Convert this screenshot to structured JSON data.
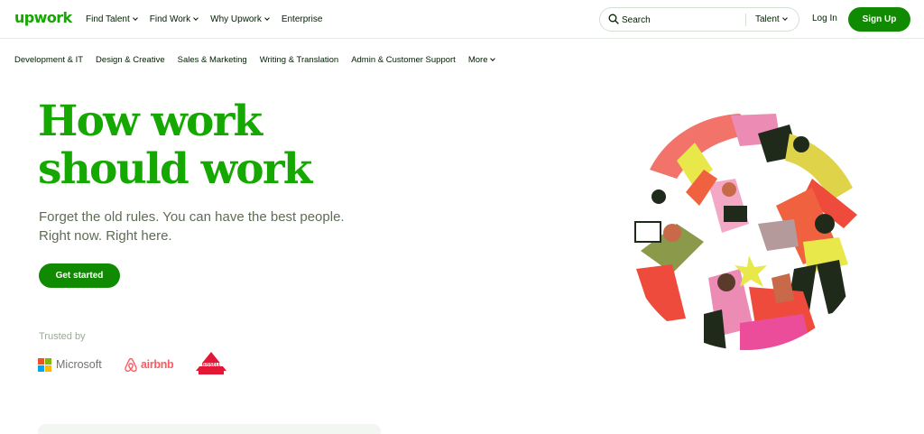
{
  "brand": {
    "logo": "upwork",
    "accent": "#14a800",
    "button_green": "#108a00"
  },
  "header": {
    "nav": [
      {
        "label": "Find Talent",
        "dropdown": true
      },
      {
        "label": "Find Work",
        "dropdown": true
      },
      {
        "label": "Why Upwork",
        "dropdown": true
      },
      {
        "label": "Enterprise",
        "dropdown": false
      }
    ],
    "search": {
      "placeholder": "Search",
      "scope": "Talent",
      "icon": "search-icon"
    },
    "login": "Log In",
    "signup": "Sign Up"
  },
  "categories": {
    "items": [
      "Development & IT",
      "Design & Creative",
      "Sales & Marketing",
      "Writing & Translation",
      "Admin & Customer Support"
    ],
    "more": "More"
  },
  "hero": {
    "title_line1": "How work",
    "title_line2": "should work",
    "subtitle_line1": "Forget the old rules. You can have the best people.",
    "subtitle_line2": "Right now. Right here.",
    "cta": "Get started"
  },
  "trusted": {
    "label": "Trusted by",
    "logos": [
      {
        "name": "Microsoft",
        "icon": "microsoft-logo",
        "colors": [
          "#f25022",
          "#7fba00",
          "#00a4ef",
          "#ffb900"
        ]
      },
      {
        "name": "airbnb",
        "icon": "airbnb-logo",
        "color": "#ff5a5f"
      },
      {
        "name": "BISSELL",
        "icon": "bissell-logo",
        "color": "#e31837"
      }
    ]
  },
  "illustration": {
    "icon": "people-collaborating-illustration"
  }
}
